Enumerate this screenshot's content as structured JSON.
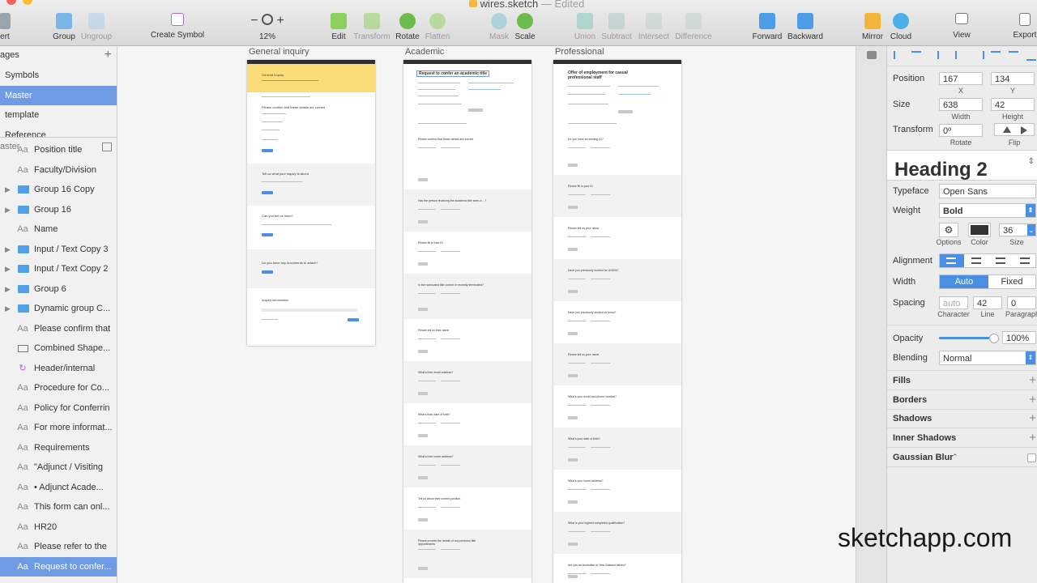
{
  "window": {
    "title": "wires.sketch",
    "edited": "— Edited"
  },
  "toolbar": {
    "insert": "ert",
    "group": "Group",
    "ungroup": "Ungroup",
    "create_symbol": "Create Symbol",
    "zoom_minus": "−",
    "zoom_plus": "+",
    "zoom_value": "12%",
    "edit": "Edit",
    "transform": "Transform",
    "rotate": "Rotate",
    "flatten": "Flatten",
    "mask": "Mask",
    "scale": "Scale",
    "union": "Union",
    "subtract": "Subtract",
    "intersect": "Intersect",
    "difference": "Difference",
    "forward": "Forward",
    "backward": "Backward",
    "mirror": "Mirror",
    "cloud": "Cloud",
    "view": "View",
    "export": "Export"
  },
  "pages": {
    "header": "ages",
    "add": "+",
    "items": [
      "Symbols",
      "Master",
      "template",
      "Reference"
    ]
  },
  "layers": {
    "filter": "aster",
    "items": [
      {
        "type": "Aa",
        "label": "Position title"
      },
      {
        "type": "Aa",
        "label": "Faculty/Division"
      },
      {
        "type": "folder",
        "label": "Group 16 Copy"
      },
      {
        "type": "folder",
        "label": "Group 16"
      },
      {
        "type": "Aa",
        "label": "Name"
      },
      {
        "type": "folder",
        "label": "Input / Text Copy 3"
      },
      {
        "type": "folder",
        "label": "Input / Text Copy 2"
      },
      {
        "type": "folder",
        "label": "Group 6"
      },
      {
        "type": "folder",
        "label": "Dynamic group C..."
      },
      {
        "type": "Aa",
        "label": "Please confirm that"
      },
      {
        "type": "shape",
        "label": "Combined Shape..."
      },
      {
        "type": "symbol",
        "label": "Header/internal"
      },
      {
        "type": "Aa",
        "label": "Procedure for Co..."
      },
      {
        "type": "Aa",
        "label": "Policy for Conferrin"
      },
      {
        "type": "Aa",
        "label": "For more informat..."
      },
      {
        "type": "Aa",
        "label": "Requirements"
      },
      {
        "type": "Aa",
        "label": "\"Adjunct / Visiting"
      },
      {
        "type": "Aa",
        "label": "• Adjunct Acade..."
      },
      {
        "type": "Aa",
        "label": "This form can onl..."
      },
      {
        "type": "Aa",
        "label": "HR20"
      },
      {
        "type": "Aa",
        "label": "Please refer to the"
      },
      {
        "type": "Aa",
        "label": "Request to confer..."
      }
    ]
  },
  "artboards": {
    "general": {
      "title": "General inquiry",
      "banner": "General inquiry",
      "q1": "Please confirm that these details are correct",
      "q2": "Tell us what your inquiry is about",
      "q3": "Can you tell us more?",
      "q4": "Do you have any documents to attach?",
      "q5": "Inquiry information"
    },
    "academic": {
      "title": "Academic",
      "heading": "Request to confer an academic title",
      "q1": "Please confirm that these details are correct",
      "q2": "Has the person receiving the academic title seen a ...?",
      "q3": "Please fill in their ID",
      "q4": "Is the nominated title current or recently terminated?",
      "q5": "Please tell us their name",
      "q6": "What's their email address?",
      "q7": "What's their date of birth?",
      "q8": "What's their home address?",
      "q9": "Tell us about their current position",
      "q10": "Please provide the details of any previous title appointments"
    },
    "professional": {
      "title": "Professional",
      "heading": "Offer of employment for casual professional staff",
      "q1": "Do you have an existing ID?",
      "q2": "Please fill in your ID",
      "q3": "Please tell us your name",
      "q4": "Have you previously worked for UNSW?",
      "q5": "Have you previously studied at Unsw?",
      "q6": "Please tell us your name",
      "q7": "What's your email and phone number?",
      "q8": "What's your date of birth?",
      "q9": "What's your home address?",
      "q10": "What is your highest completed qualification?",
      "q11": "Are you an Australian or New Zealand citizen?"
    }
  },
  "inspector": {
    "position": {
      "label": "Position",
      "x": "167",
      "y": "134",
      "x_label": "X",
      "y_label": "Y"
    },
    "size": {
      "label": "Size",
      "width": "638",
      "height": "42",
      "w_label": "Width",
      "h_label": "Height"
    },
    "transform": {
      "label": "Transform",
      "rotate": "0º",
      "rotate_label": "Rotate",
      "flip_label": "Flip"
    },
    "style_preview": "Heading 2",
    "typeface": {
      "label": "Typeface",
      "value": "Open Sans"
    },
    "weight": {
      "label": "Weight",
      "value": "Bold"
    },
    "options_label": "Options",
    "color_label": "Color",
    "size_value": "36",
    "size_label": "Size",
    "alignment_label": "Alignment",
    "width": {
      "label": "Width",
      "auto": "Auto",
      "fixed": "Fixed"
    },
    "spacing": {
      "label": "Spacing",
      "character": "auto",
      "line": "42",
      "paragraph": "0",
      "character_label": "Character",
      "line_label": "Line",
      "paragraph_label": "Paragraph"
    },
    "opacity": {
      "label": "Opacity",
      "value": "100%",
      "level": 1.0
    },
    "blending": {
      "label": "Blending",
      "value": "Normal"
    },
    "sections": [
      "Fills",
      "Borders",
      "Shadows",
      "Inner Shadows",
      "Gaussian Blur"
    ],
    "blur_caret": "⌃"
  },
  "watermark": "sketchapp.com",
  "colors": {
    "selection": "#6f9be4",
    "accent": "#4a90e2",
    "banner": "#fbdc78",
    "text_color_swatch": "#333333"
  }
}
